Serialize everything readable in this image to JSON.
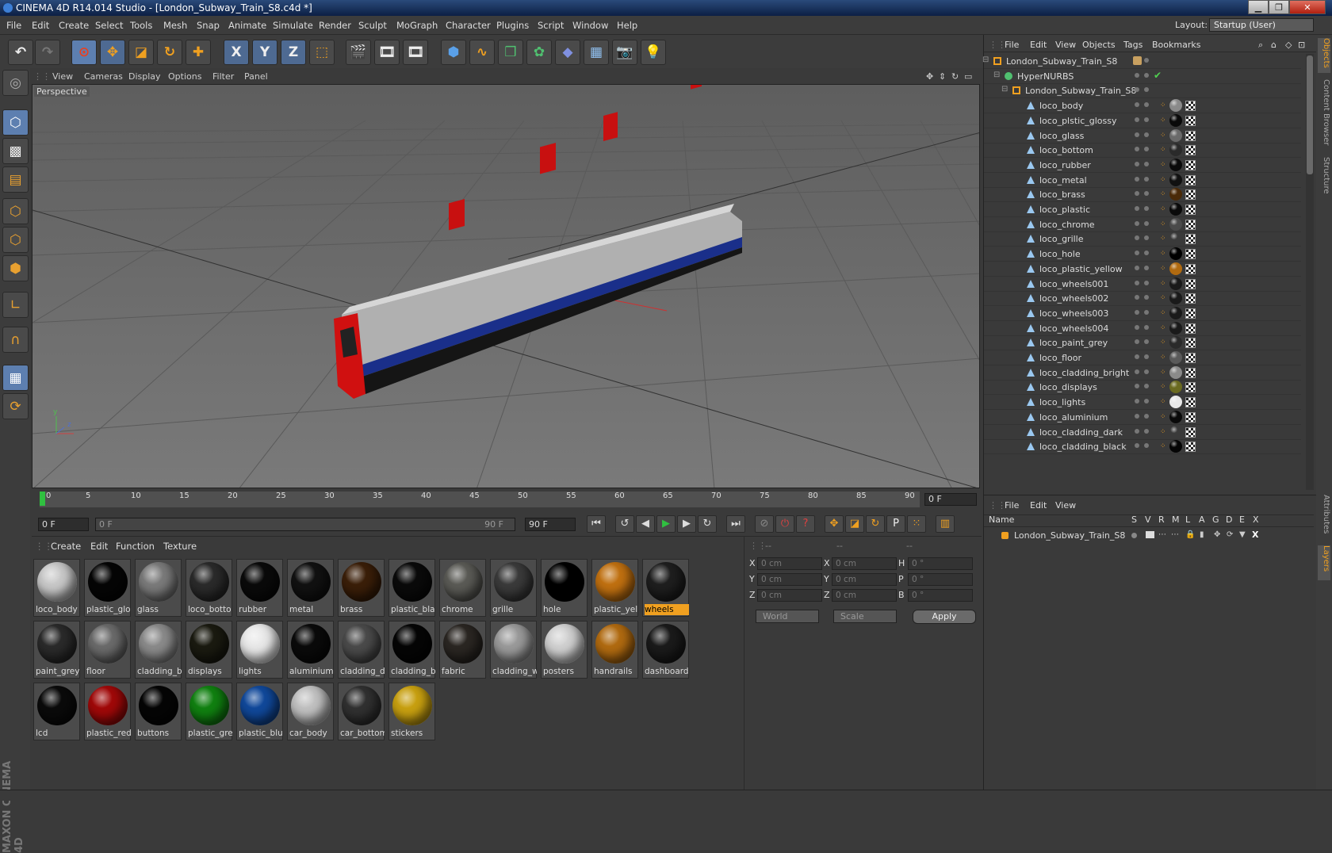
{
  "window": {
    "title": "CINEMA 4D R14.014 Studio - [London_Subway_Train_S8.c4d *]",
    "min": "▁",
    "max": "❐",
    "close": "✕"
  },
  "menu": {
    "items": [
      "File",
      "Edit",
      "Create",
      "Select",
      "Tools",
      "Mesh",
      "Snap",
      "Animate",
      "Simulate",
      "Render",
      "Sculpt",
      "MoGraph",
      "Character",
      "Plugins",
      "Script",
      "Window",
      "Help"
    ],
    "layout_label": "Layout:",
    "layout_value": "Startup (User)"
  },
  "toolbar": {
    "axis_x": "X",
    "axis_y": "Y",
    "axis_z": "Z"
  },
  "viewport": {
    "menu": [
      "View",
      "Cameras",
      "Display",
      "Options",
      "Filter",
      "Panel"
    ],
    "label": "Perspective",
    "axis_y": "y",
    "axis_z": "z"
  },
  "timeline": {
    "ticks": [
      "0",
      "5",
      "10",
      "15",
      "20",
      "25",
      "30",
      "35",
      "40",
      "45",
      "50",
      "55",
      "60",
      "65",
      "70",
      "75",
      "80",
      "85",
      "90"
    ],
    "end_field": "0 F"
  },
  "transport": {
    "start_field": "0 F",
    "range_start": "0 F",
    "range_end": "90 F",
    "end_field": "90 F"
  },
  "materials": {
    "menu": [
      "Create",
      "Edit",
      "Function",
      "Texture"
    ],
    "items": [
      {
        "name": "loco_body",
        "color": "#c8c8c8"
      },
      {
        "name": "plastic_glo",
        "color": "#050505"
      },
      {
        "name": "glass",
        "color": "#7a7a7a"
      },
      {
        "name": "loco_botto",
        "color": "#2a2a2a"
      },
      {
        "name": "rubber",
        "color": "#0a0a0a"
      },
      {
        "name": "metal",
        "color": "#111111"
      },
      {
        "name": "brass",
        "color": "#3a1e08"
      },
      {
        "name": "plastic_bla",
        "color": "#0a0a0a"
      },
      {
        "name": "chrome",
        "color": "#5a5a55"
      },
      {
        "name": "grille",
        "color": "#3a3a3a"
      },
      {
        "name": "hole",
        "color": "#000000"
      },
      {
        "name": "plastic_yell",
        "color": "#c07010"
      },
      {
        "name": "wheels",
        "color": "#1e1e1e",
        "selected": true
      },
      {
        "name": "paint_grey",
        "color": "#2a2a2a"
      },
      {
        "name": "floor",
        "color": "#6a6a6a"
      },
      {
        "name": "cladding_b",
        "color": "#8a8a8a"
      },
      {
        "name": "displays",
        "color": "#1a1a10"
      },
      {
        "name": "lights",
        "color": "#e8e8e8"
      },
      {
        "name": "aluminium",
        "color": "#0a0a0a"
      },
      {
        "name": "cladding_d",
        "color": "#4a4a4a"
      },
      {
        "name": "cladding_b",
        "color": "#050505"
      },
      {
        "name": "fabric",
        "color": "#2a2622"
      },
      {
        "name": "cladding_w",
        "color": "#9a9a9a"
      },
      {
        "name": "posters",
        "color": "#d0d0d0"
      },
      {
        "name": "handrails",
        "color": "#b06a10"
      },
      {
        "name": "dashboard",
        "color": "#1a1a1a"
      },
      {
        "name": "lcd",
        "color": "#0a0a0a"
      },
      {
        "name": "plastic_red",
        "color": "#a00808"
      },
      {
        "name": "buttons",
        "color": "#050505"
      },
      {
        "name": "plastic_gre",
        "color": "#108010"
      },
      {
        "name": "plastic_blu",
        "color": "#10489a"
      },
      {
        "name": "car_body",
        "color": "#c0c0c0"
      },
      {
        "name": "car_bottom",
        "color": "#303030"
      },
      {
        "name": "stickers",
        "color": "#c8a010"
      }
    ]
  },
  "attributes": {
    "rows": [
      {
        "l1": "X",
        "v1": "0 cm",
        "l2": "X",
        "v2": "0 cm",
        "l3": "H",
        "v3": "0 °"
      },
      {
        "l1": "Y",
        "v1": "0 cm",
        "l2": "Y",
        "v2": "0 cm",
        "l3": "P",
        "v3": "0 °"
      },
      {
        "l1": "Z",
        "v1": "0 cm",
        "l2": "Z",
        "v2": "0 cm",
        "l3": "B",
        "v3": "0 °"
      }
    ],
    "header1": "--",
    "header2": "--",
    "header3": "--",
    "coord_system": "World",
    "mode": "Scale",
    "apply": "Apply"
  },
  "objects": {
    "menu": [
      "File",
      "Edit",
      "View",
      "Objects",
      "Tags",
      "Bookmarks"
    ],
    "root": "London_Subway_Train_S8",
    "hypernurbs": "HyperNURBS",
    "group": "London_Subway_Train_S8",
    "children": [
      {
        "name": "loco_body",
        "tag": "#8a8a8a"
      },
      {
        "name": "loco_plstic_glossy",
        "tag": "#0a0a0a"
      },
      {
        "name": "loco_glass",
        "tag": "#6a6a6a"
      },
      {
        "name": "loco_bottom",
        "tag": "#2a2a2a"
      },
      {
        "name": "loco_rubber",
        "tag": "#0a0a0a"
      },
      {
        "name": "loco_metal",
        "tag": "#111111"
      },
      {
        "name": "loco_brass",
        "tag": "#4a2a08"
      },
      {
        "name": "loco_plastic",
        "tag": "#0a0a0a"
      },
      {
        "name": "loco_chrome",
        "tag": "#4a4a4a"
      },
      {
        "name": "loco_grille",
        "tag": "#3a3a3a"
      },
      {
        "name": "loco_hole",
        "tag": "#000000"
      },
      {
        "name": "loco_plastic_yellow",
        "tag": "#b06a10"
      },
      {
        "name": "loco_wheels001",
        "tag": "#1a1a1a"
      },
      {
        "name": "loco_wheels002",
        "tag": "#1a1a1a"
      },
      {
        "name": "loco_wheels003",
        "tag": "#1a1a1a"
      },
      {
        "name": "loco_wheels004",
        "tag": "#1a1a1a"
      },
      {
        "name": "loco_paint_grey",
        "tag": "#2a2a2a"
      },
      {
        "name": "loco_floor",
        "tag": "#5a5a5a"
      },
      {
        "name": "loco_cladding_bright",
        "tag": "#8a8a8a"
      },
      {
        "name": "loco_displays",
        "tag": "#6a6a20"
      },
      {
        "name": "loco_lights",
        "tag": "#e8e8e8"
      },
      {
        "name": "loco_aluminium",
        "tag": "#0a0a0a"
      },
      {
        "name": "loco_cladding_dark",
        "tag": "#3a3a3a"
      },
      {
        "name": "loco_cladding_black",
        "tag": "#050505"
      }
    ]
  },
  "layers": {
    "menu": [
      "File",
      "Edit",
      "View"
    ],
    "header_name": "Name",
    "header_cols": [
      "S",
      "V",
      "R",
      "M",
      "L",
      "A",
      "G",
      "D",
      "E",
      "X"
    ],
    "row": "London_Subway_Train_S8"
  },
  "siderail": {
    "tabs": [
      "Objects",
      "Content Browser",
      "Structure",
      "Attributes",
      "Layers"
    ]
  },
  "branding": {
    "maxon": "MAXON CINEMA 4D"
  },
  "colors": {
    "accent": "#f0a020",
    "selection": "#5d7fb0",
    "train_red": "#d01010"
  }
}
